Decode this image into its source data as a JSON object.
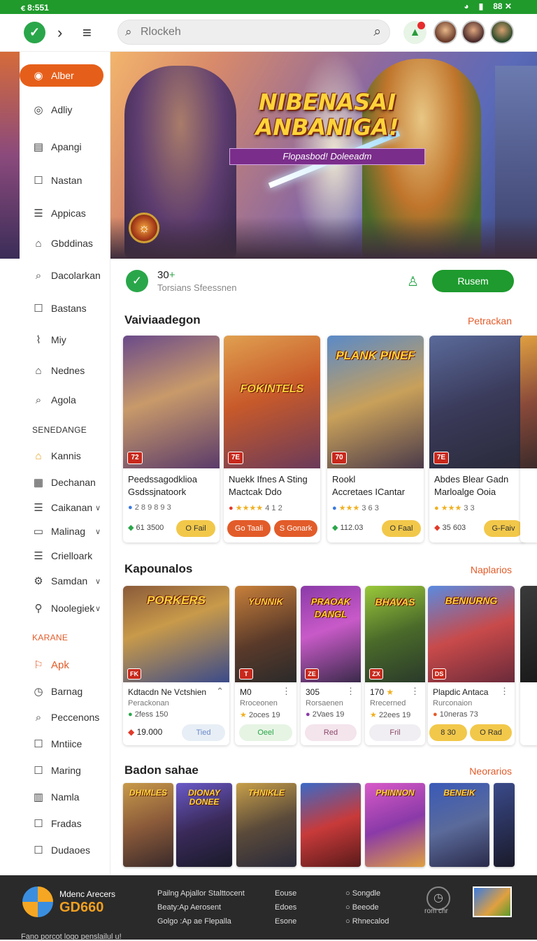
{
  "status": {
    "left": "ꞓ 8:551",
    "right": [
      "◕",
      "▮",
      "88 ✕"
    ]
  },
  "header": {
    "search_placeholder": "Rlockeh"
  },
  "sidebar": {
    "items": [
      {
        "label": "Alber",
        "icon": "flame-icon"
      },
      {
        "label": "Adliy",
        "icon": "target-icon"
      },
      {
        "label": "Apangi",
        "icon": "card-icon"
      },
      {
        "label": "Nastan",
        "icon": "square-icon"
      },
      {
        "label": "Appicas",
        "icon": "list-icon"
      },
      {
        "label": "Gbddinas",
        "icon": "tag-icon"
      },
      {
        "label": "Dacolarkan",
        "icon": "search-icon"
      },
      {
        "label": "Bastans",
        "icon": "chat-icon"
      },
      {
        "label": "Miy",
        "icon": "link-icon"
      },
      {
        "label": "Nednes",
        "icon": "tag-icon"
      },
      {
        "label": "Agola",
        "icon": "search-icon"
      }
    ],
    "section1": "SENEDANGE",
    "items2": [
      {
        "label": "Kannis",
        "icon": "home-icon"
      },
      {
        "label": "Dechanan",
        "icon": "grid-icon"
      },
      {
        "label": "Caikanan",
        "icon": "list-icon"
      },
      {
        "label": "Malinag",
        "icon": "card-icon"
      },
      {
        "label": "Crielloark",
        "icon": "list-icon"
      },
      {
        "label": "Samdan",
        "icon": "gear-icon"
      },
      {
        "label": "Noolegiek",
        "icon": "user-icon"
      }
    ],
    "section2": "KARANE",
    "items3": [
      {
        "label": "Apk",
        "icon": "bookmark-icon"
      },
      {
        "label": "Barnag",
        "icon": "clock-icon"
      },
      {
        "label": "Peccenons",
        "icon": "search-icon"
      },
      {
        "label": "Mntiice",
        "icon": "square-icon"
      },
      {
        "label": "Maring",
        "icon": "square-icon"
      },
      {
        "label": "Namla",
        "icon": "chart-icon"
      },
      {
        "label": "Fradas",
        "icon": "square-icon"
      },
      {
        "label": "Dudaoes",
        "icon": "square-icon"
      }
    ]
  },
  "hero": {
    "title": "NIBENASAI ANBANIGA!",
    "subtitle": "Flopasbod! Doleeadm",
    "badge": "☼"
  },
  "summary": {
    "count": "30",
    "plus": "+",
    "caption": "Torsians Sfeessnen",
    "button": "Rusem"
  },
  "section1": {
    "title": "Vaiviaadegon",
    "link": "Petrackan",
    "cards": [
      {
        "tag": "72",
        "t1": "Peedssagodklioa",
        "t2": "Gsdssjnatoork",
        "meta": "2 8 9 8 9 3",
        "price": "61 3500",
        "b1": "O Fail",
        "b1c": "#f2c84a",
        "art": "linear-gradient(160deg,#6a4a8a,#c89a6a 45%,#5a3a6a)",
        "arttitle": ""
      },
      {
        "tag": "7E",
        "t1": "Nuekk Ifnes A Sting",
        "t2": "Mactcak Ddo",
        "meta": "4 1 2",
        "price": "",
        "b1": "Go Taali",
        "b1c": "#e25c2a",
        "b2": "S Gonark",
        "art": "linear-gradient(160deg,#e0a050,#c85a2a 45%,#6a3a5a)",
        "arttitle": "FOKINTELS"
      },
      {
        "tag": "70",
        "t1": "Rookl",
        "t2": "Accretaes ICantar",
        "meta": "3 6 3",
        "price": "112.03",
        "b1": "O Faal",
        "b1c": "#f2c84a",
        "art": "linear-gradient(160deg,#5a8ac8,#c8a05a 50%,#4a3a4a)",
        "arttitle": "PLANK PINEF"
      },
      {
        "tag": "7E",
        "t1": "Abdes Blear Gadn",
        "t2": "Marloalge Ooia",
        "meta": "3 3",
        "price": "35 603",
        "b1": "G-Faiv",
        "b1c": "#f2c84a",
        "art": "linear-gradient(160deg,#5a6a9a,#3a3a5a 50%,#2a2a3a)",
        "arttitle": ""
      }
    ]
  },
  "section2": {
    "title": "Kapounalos",
    "link": "Naplarios",
    "cards": [
      {
        "tag": "FK",
        "t1": "Kdtacdn Ne Vctshien",
        "t2": "Perackonan",
        "meta": "2fess 150",
        "price": "19.000",
        "b": "Tied",
        "art": "linear-gradient(160deg,#8a5a3a,#c89a4a 40%,#3a4a8a)",
        "arttitle": "PORKERS"
      },
      {
        "tag": "T",
        "t1": "M0",
        "t2": "Rroceonen",
        "meta": "2oces 19",
        "b": "Oeel",
        "art": "linear-gradient(160deg,#c8803a,#5a3a2a 55%,#2a2a2a)",
        "arttitle": "YUNNIK"
      },
      {
        "tag": "ZE",
        "t1": "305",
        "t2": "Rorsaenen",
        "meta": "2Vaes 19",
        "b": "Red",
        "art": "linear-gradient(160deg,#8a3aa8,#c85ac8 45%,#3a2a4a)",
        "arttitle": "PRAOAK DANGL"
      },
      {
        "tag": "ZX",
        "t1": "170",
        "t2": "Rrecerned",
        "meta": "22ees 19",
        "b": "Fril",
        "art": "linear-gradient(160deg,#9ac83a,#4a6a2a 50%,#2a3a2a)",
        "arttitle": "BHAVAS"
      },
      {
        "tag": "DS",
        "t1": "Plapdic Antaca",
        "t2": "Rurconaion",
        "meta": "10neras 73",
        "b": "O Rad",
        "b0": "8 30",
        "art": "linear-gradient(160deg,#5a8ae0,#c84a4a 50%,#6a2a3a)",
        "arttitle": "BENIURNG"
      }
    ]
  },
  "section3": {
    "title": "Badon sahae",
    "link": "Neorarios",
    "thumbs": [
      {
        "label": "DHIMLES",
        "art": "linear-gradient(160deg,#c89a4a,#8a5a3a 50%,#3a2a2a)"
      },
      {
        "label": "DIONAY DONEE",
        "art": "linear-gradient(160deg,#6a5ac8,#3a2a5a 50%,#1a1a2a)"
      },
      {
        "label": "THNIKLE",
        "art": "linear-gradient(160deg,#c8a04a,#5a4a3a 50%,#2a2a3a)"
      },
      {
        "label": "",
        "art": "linear-gradient(160deg,#3a6ac8,#c83a3a 50%,#5a1a1a)"
      },
      {
        "label": "PHINNON",
        "art": "linear-gradient(160deg,#d85ac8,#8a3aa8 50%,#e0a040)"
      },
      {
        "label": "BENEIK",
        "art": "linear-gradient(160deg,#3a5ab8,#5a6a9a 50%,#2a2a4a)"
      }
    ]
  },
  "footer": {
    "name": "Mdenc Arecers",
    "brand": "GD660",
    "col1": [
      "Pailng Apjallor Stalttocent",
      "Beaty:Ap Aerosent",
      "Golgo :Ap ae Flepalla"
    ],
    "col2": [
      "Eouse",
      "Edoes",
      "Esone"
    ],
    "col3": [
      "Songdle",
      "Beeode",
      "Rhnecalod"
    ],
    "small": "rom chr",
    "bottom": "Fano porcot logo penslailul u!"
  }
}
